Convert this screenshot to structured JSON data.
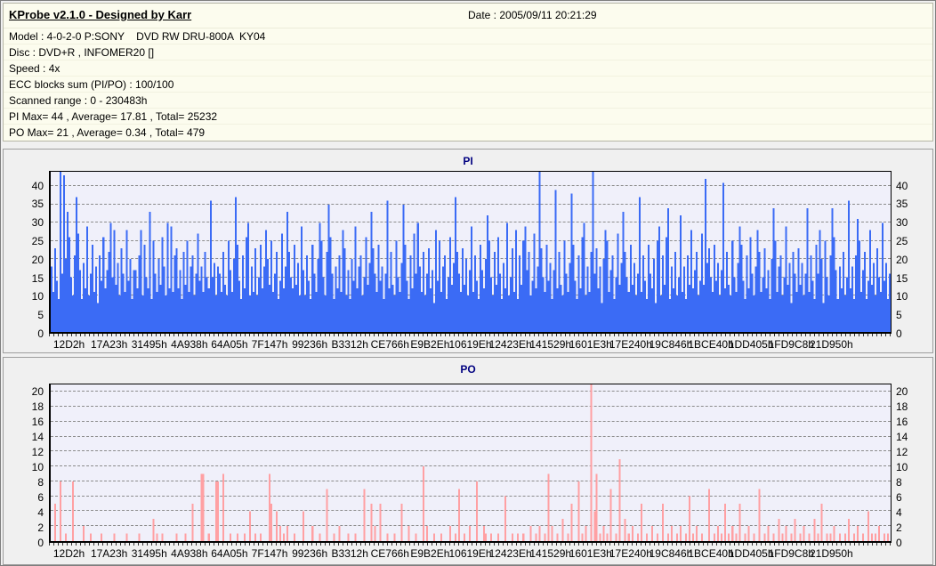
{
  "header": {
    "title": "KProbe v2.1.0 - Designed by Karr",
    "date_label": "Date : 2005/09/11 20:21:29"
  },
  "info": {
    "lines": [
      "Model : 4-0-2-0 P:SONY    DVD RW DRU-800A  KY04",
      "Disc : DVD+R , INFOMER20 []",
      "Speed : 4x",
      "ECC blocks sum (PI/PO) : 100/100",
      "Scanned range : 0 - 230483h",
      "PI Max= 44 , Average= 17.81 , Total= 25232",
      "PO Max= 21 , Average= 0.34 , Total= 479"
    ]
  },
  "colors": {
    "header_bg": "#fcfcee",
    "panel_bg": "#f0f0f0",
    "plot_bg": "#f0f0fa",
    "chart_title": "#000080",
    "pi_bar": "#3b6bf5",
    "po_bar": "#ffa0a3",
    "gridline": "#8c8c8c"
  },
  "chart_data": [
    {
      "type": "bar",
      "title": "PI",
      "xlabel": "",
      "ylabel": "",
      "ylim": [
        0,
        44
      ],
      "yticks": [
        0,
        5,
        10,
        15,
        20,
        25,
        30,
        35,
        40
      ],
      "grid": true,
      "legend": "none",
      "bar_color": "#3b6bf5",
      "plot_bg": "#f0f0fa",
      "stats": {
        "max": 44,
        "average": 17.81,
        "total": 25232
      },
      "categories": [
        "12D2h",
        "17A23h",
        "31495h",
        "4A938h",
        "64A05h",
        "7F147h",
        "99236h",
        "B3312h",
        "CE766h",
        "E9B2Eh",
        "10619Eh",
        "12423Eh",
        "141529h",
        "1601E3h",
        "17E240h",
        "19C846h",
        "1BCE40h",
        "1DD405h",
        "1FD9C8h",
        "21D950h"
      ],
      "values": [
        18,
        11,
        23,
        14,
        9,
        44,
        16,
        43,
        20,
        33,
        26,
        15,
        10,
        21,
        37,
        27,
        17,
        9,
        19,
        12,
        29,
        10,
        16,
        24,
        11,
        18,
        8,
        21,
        14,
        26,
        12,
        17,
        22,
        30,
        15,
        28,
        13,
        19,
        10,
        23,
        16,
        11,
        28,
        14,
        20,
        9,
        17,
        17,
        12,
        21,
        28,
        10,
        24,
        15,
        12,
        33,
        9,
        25,
        16,
        11,
        20,
        13,
        26,
        18,
        10,
        30,
        12,
        29,
        11,
        21,
        23,
        12,
        17,
        9,
        22,
        13,
        25,
        11,
        18,
        21,
        10,
        16,
        27,
        14,
        18,
        11,
        22,
        15,
        12,
        36,
        15,
        19,
        10,
        18,
        16,
        11,
        22,
        13,
        10,
        25,
        17,
        11,
        20,
        37,
        24,
        14,
        9,
        21,
        12,
        26,
        30,
        10,
        18,
        11,
        23,
        10,
        15,
        24,
        12,
        18,
        28,
        20,
        13,
        25,
        11,
        16,
        22,
        9,
        14,
        27,
        12,
        18,
        33,
        22,
        15,
        12,
        24,
        13,
        19,
        10,
        29,
        17,
        10,
        21,
        14,
        9,
        24,
        16,
        11,
        20,
        30,
        25,
        15,
        10,
        22,
        35,
        26,
        16,
        9,
        18,
        12,
        21,
        11,
        28,
        23,
        10,
        17,
        9,
        20,
        14,
        29,
        12,
        18,
        21,
        10,
        15,
        26,
        13,
        19,
        33,
        23,
        16,
        11,
        24,
        14,
        18,
        9,
        16,
        36,
        12,
        22,
        13,
        10,
        25,
        15,
        11,
        19,
        35,
        24,
        14,
        9,
        21,
        12,
        27,
        16,
        30,
        18,
        11,
        22,
        10,
        16,
        23,
        12,
        17,
        8,
        28,
        14,
        25,
        11,
        18,
        21,
        9,
        15,
        26,
        13,
        19,
        37,
        22,
        16,
        11,
        23,
        13,
        20,
        10,
        17,
        29,
        11,
        21,
        14,
        9,
        24,
        17,
        12,
        20,
        32,
        25,
        15,
        10,
        22,
        13,
        26,
        16,
        9,
        19,
        12,
        30,
        10,
        15,
        23,
        11,
        28,
        9,
        21,
        13,
        25,
        29,
        17,
        22,
        10,
        14,
        27,
        12,
        18,
        44,
        23,
        15,
        11,
        24,
        14,
        19,
        9,
        17,
        39,
        12,
        22,
        13,
        10,
        25,
        16,
        11,
        19,
        38,
        24,
        14,
        9,
        21,
        12,
        26,
        30,
        10,
        18,
        11,
        22,
        44,
        16,
        23,
        12,
        18,
        8,
        20,
        28,
        25,
        11,
        17,
        21,
        9,
        15,
        27,
        13,
        19,
        33,
        22,
        15,
        11,
        24,
        13,
        19,
        10,
        16,
        37,
        11,
        21,
        14,
        9,
        24,
        16,
        12,
        20,
        8,
        25,
        29,
        10,
        21,
        13,
        26,
        34,
        9,
        18,
        12,
        22,
        10,
        15,
        32,
        11,
        18,
        9,
        21,
        13,
        28,
        12,
        17,
        22,
        10,
        14,
        27,
        13,
        42,
        19,
        23,
        15,
        11,
        24,
        14,
        19,
        10,
        17,
        41,
        12,
        22,
        13,
        10,
        25,
        15,
        11,
        19,
        29,
        24,
        14,
        9,
        21,
        12,
        26,
        16,
        10,
        18,
        28,
        22,
        11,
        15,
        23,
        12,
        17,
        9,
        20,
        34,
        25,
        11,
        18,
        21,
        10,
        15,
        29,
        13,
        19,
        8,
        22,
        16,
        11,
        23,
        13,
        19,
        10,
        16,
        34,
        11,
        21,
        14,
        9,
        24,
        16,
        28,
        20,
        8,
        25,
        15,
        10,
        21,
        34,
        26,
        17,
        9,
        18,
        12,
        22,
        10,
        15,
        36,
        12,
        18,
        9,
        21,
        31,
        25,
        11,
        17,
        22,
        9,
        14,
        28,
        13,
        19,
        10,
        23,
        15,
        11,
        30,
        14,
        19,
        9,
        16
      ]
    },
    {
      "type": "bar",
      "title": "PO",
      "xlabel": "",
      "ylabel": "",
      "ylim": [
        0,
        21
      ],
      "yticks": [
        0,
        2,
        4,
        6,
        8,
        10,
        12,
        14,
        16,
        18,
        20
      ],
      "grid": true,
      "legend": "none",
      "bar_color": "#ffa0a3",
      "plot_bg": "#f0f0fa",
      "stats": {
        "max": 21,
        "average": 0.34,
        "total": 479
      },
      "categories": [
        "12D2h",
        "17A23h",
        "31495h",
        "4A938h",
        "64A05h",
        "7F147h",
        "99236h",
        "B3312h",
        "CE766h",
        "E9B2Eh",
        "10619Eh",
        "12423Eh",
        "141529h",
        "1601E3h",
        "17E240h",
        "19C846h",
        "1BCE40h",
        "1DD405h",
        "1FD9C8h",
        "21D950h"
      ],
      "values": [
        0,
        0,
        5,
        0,
        0,
        8,
        0,
        0,
        1,
        0,
        0,
        0,
        8,
        0,
        0,
        0,
        0,
        0,
        2,
        0,
        0,
        0,
        1,
        0,
        0,
        0,
        0,
        0,
        1,
        0,
        0,
        0,
        0,
        0,
        0,
        1,
        0,
        0,
        0,
        0,
        0,
        0,
        1,
        0,
        0,
        0,
        0,
        0,
        0,
        1,
        0,
        0,
        0,
        0,
        0,
        0,
        0,
        3,
        0,
        1,
        0,
        0,
        1,
        0,
        0,
        0,
        0,
        0,
        0,
        0,
        1,
        0,
        0,
        0,
        0,
        1,
        0,
        0,
        0,
        5,
        0,
        0,
        0,
        0,
        9,
        9,
        0,
        0,
        1,
        0,
        0,
        0,
        8,
        8,
        0,
        0,
        9,
        0,
        0,
        0,
        1,
        0,
        0,
        0,
        1,
        0,
        0,
        0,
        1,
        0,
        0,
        4,
        0,
        0,
        1,
        0,
        0,
        1,
        0,
        0,
        0,
        0,
        9,
        5,
        0,
        0,
        4,
        0,
        2,
        0,
        1,
        0,
        2,
        0,
        0,
        0,
        1,
        0,
        0,
        0,
        0,
        4,
        0,
        0,
        0,
        0,
        2,
        0,
        0,
        0,
        1,
        0,
        0,
        0,
        7,
        0,
        0,
        0,
        1,
        0,
        0,
        2,
        0,
        0,
        0,
        0,
        1,
        0,
        0,
        0,
        1,
        0,
        0,
        0,
        0,
        7,
        0,
        0,
        0,
        5,
        0,
        2,
        0,
        0,
        5,
        0,
        0,
        0,
        1,
        0,
        0,
        0,
        1,
        0,
        0,
        0,
        5,
        0,
        0,
        0,
        2,
        0,
        0,
        0,
        1,
        0,
        0,
        0,
        10,
        0,
        2,
        0,
        0,
        0,
        1,
        0,
        0,
        0,
        1,
        0,
        0,
        0,
        0,
        2,
        0,
        0,
        1,
        0,
        7,
        0,
        0,
        1,
        0,
        0,
        2,
        0,
        0,
        0,
        8,
        0,
        0,
        0,
        2,
        1,
        0,
        0,
        1,
        0,
        0,
        0,
        1,
        0,
        0,
        0,
        6,
        0,
        0,
        0,
        1,
        0,
        0,
        1,
        0,
        0,
        1,
        0,
        0,
        0,
        2,
        0,
        0,
        1,
        0,
        2,
        0,
        0,
        1,
        0,
        9,
        0,
        2,
        0,
        0,
        1,
        0,
        0,
        3,
        0,
        0,
        1,
        0,
        5,
        0,
        0,
        0,
        8,
        0,
        1,
        0,
        2,
        0,
        0,
        21,
        0,
        4,
        9,
        0,
        1,
        0,
        2,
        0,
        1,
        0,
        7,
        0,
        0,
        1,
        0,
        11,
        0,
        0,
        3,
        0,
        1,
        0,
        2,
        0,
        0,
        1,
        0,
        5,
        0,
        0,
        1,
        0,
        0,
        2,
        0,
        0,
        1,
        0,
        0,
        5,
        0,
        0,
        1,
        0,
        2,
        0,
        0,
        1,
        0,
        2,
        0,
        0,
        1,
        0,
        6,
        0,
        1,
        0,
        2,
        0,
        0,
        1,
        0,
        0,
        0,
        7,
        0,
        0,
        1,
        0,
        2,
        0,
        1,
        0,
        5,
        0,
        1,
        0,
        2,
        0,
        1,
        0,
        5,
        0,
        0,
        1,
        0,
        2,
        0,
        0,
        1,
        0,
        0,
        7,
        0,
        0,
        1,
        0,
        2,
        0,
        0,
        1,
        0,
        0,
        3,
        0,
        1,
        0,
        2,
        0,
        0,
        1,
        0,
        3,
        0,
        0,
        1,
        0,
        2,
        0,
        0,
        1,
        0,
        0,
        3,
        0,
        1,
        0,
        5,
        0,
        0,
        1,
        0,
        1,
        0,
        2,
        0,
        0,
        1,
        0,
        0,
        1,
        0,
        3,
        0,
        0,
        1,
        0,
        2,
        0,
        0,
        1,
        0,
        0,
        4,
        0,
        1,
        0,
        1,
        0,
        2,
        0,
        0,
        1,
        0,
        1,
        0
      ]
    }
  ]
}
